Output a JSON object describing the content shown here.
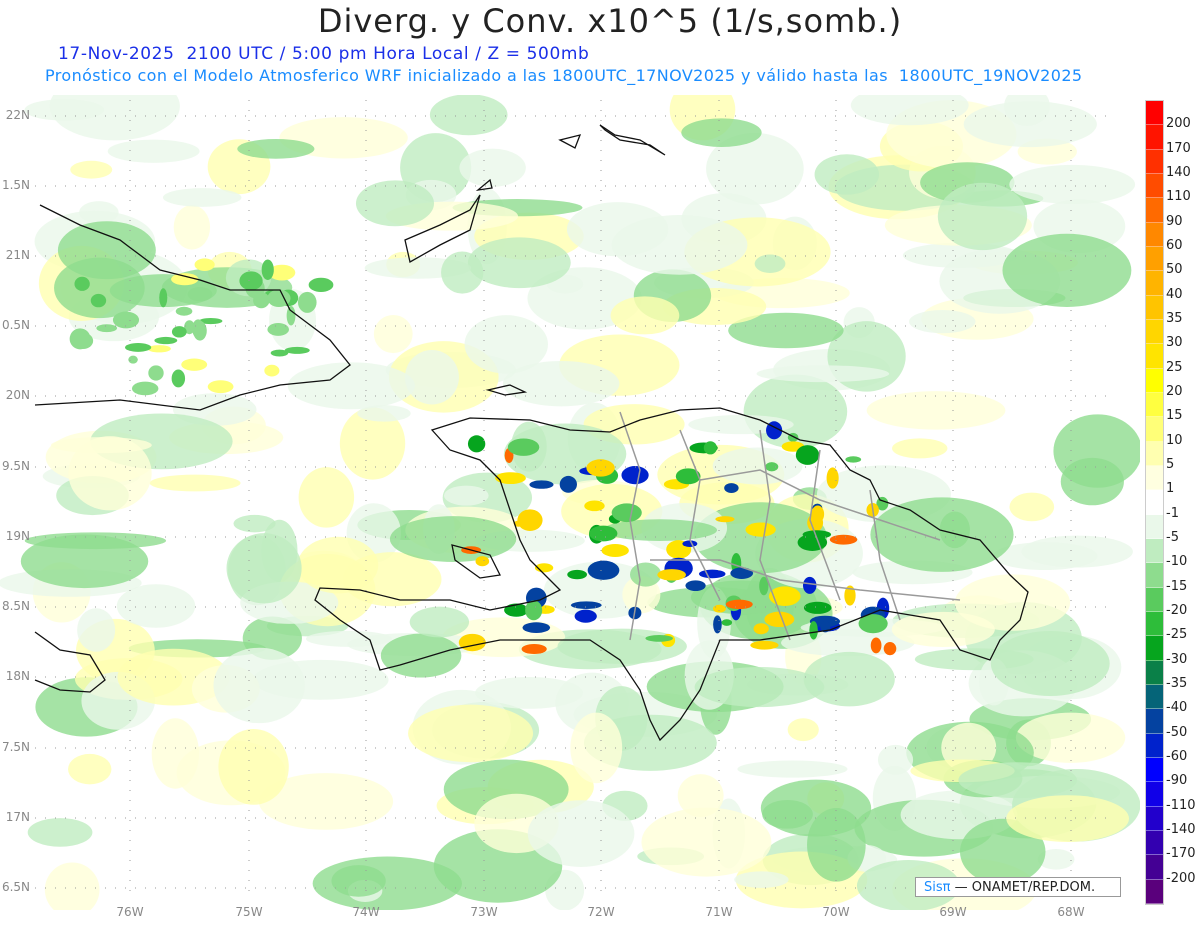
{
  "header": {
    "title": "Diverg. y Conv. x10^5 (1/s,somb.)",
    "valid_time": "17-Nov-2025  2100 UTC / 5:00 pm Hora Local / Z = 500mb",
    "forecast_info": "Pronóstico con el Modelo Atmosferico WRF inicializado a las 1800UTC_17NOV2025 y válido hasta las  1800UTC_19NOV2025"
  },
  "axes": {
    "lat_labels": [
      "22N",
      "1.5N",
      "21N",
      "0.5N",
      "20N",
      "9.5N",
      "19N",
      "8.5N",
      "18N",
      "7.5N",
      "17N",
      "6.5N"
    ],
    "lon_labels": [
      "76W",
      "75W",
      "74W",
      "73W",
      "72W",
      "71W",
      "70W",
      "69W",
      "68W"
    ]
  },
  "colorbar": {
    "labels": [
      "200",
      "170",
      "140",
      "110",
      "90",
      "60",
      "50",
      "40",
      "35",
      "30",
      "25",
      "20",
      "15",
      "10",
      "5",
      "1",
      "-1",
      "-5",
      "-10",
      "-15",
      "-20",
      "-25",
      "-30",
      "-35",
      "-40",
      "-50",
      "-60",
      "-90",
      "-110",
      "-140",
      "-170",
      "-200"
    ],
    "colors": [
      "#ff0000",
      "#ff1400",
      "#ff3000",
      "#ff4c00",
      "#ff6a00",
      "#ff8800",
      "#ffa000",
      "#ffb400",
      "#ffc400",
      "#ffd600",
      "#ffe400",
      "#ffff00",
      "#ffff40",
      "#ffff78",
      "#ffffb0",
      "#ffffe0",
      "#ffffff",
      "#eaf8ea",
      "#bfecc0",
      "#8edc8e",
      "#5acb5e",
      "#2ebd3a",
      "#06a51e",
      "#0a8048",
      "#056478",
      "#0442a0",
      "#0022cc",
      "#0000ff",
      "#1000e8",
      "#2200cc",
      "#3300b0",
      "#440094",
      "#5a007c"
    ]
  },
  "credit": {
    "brand": "Sisπ",
    "text": " — ONAMET/REP.DOM."
  }
}
